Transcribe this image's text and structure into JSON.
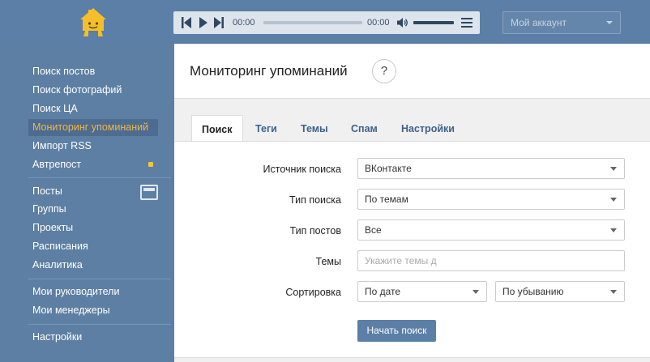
{
  "player": {
    "time_current": "00:00",
    "time_total": "00:00"
  },
  "account": {
    "label": "Мой аккаунт"
  },
  "sidebar": {
    "group1": [
      "Поиск постов",
      "Поиск фотографий",
      "Поиск ЦА",
      "Мониторинг упоминаний",
      "Импорт RSS",
      "Автрепост"
    ],
    "group2": [
      "Посты",
      "Группы",
      "Проекты",
      "Расписания",
      "Аналитика"
    ],
    "group3": [
      "Мои руководители",
      "Мои менеджеры"
    ],
    "group4": [
      "Настройки"
    ]
  },
  "page": {
    "title": "Мониторинг упоминаний",
    "help": "?"
  },
  "tabs": [
    "Поиск",
    "Теги",
    "Темы",
    "Спам",
    "Настройки"
  ],
  "form": {
    "source_label": "Источник поиска",
    "source_value": "ВКонтакте",
    "type_label": "Тип поиска",
    "type_value": "По темам",
    "posts_label": "Тип постов",
    "posts_value": "Все",
    "topics_label": "Темы",
    "topics_placeholder": "Укажите темы д",
    "sort_label": "Сортировка",
    "sort_value": "По дате",
    "order_value": "По убыванию",
    "submit": "Начать поиск"
  },
  "colors": {
    "accent": "#5b7fa6",
    "active_item": "#f0b54a",
    "badge": "#f3c53c"
  }
}
